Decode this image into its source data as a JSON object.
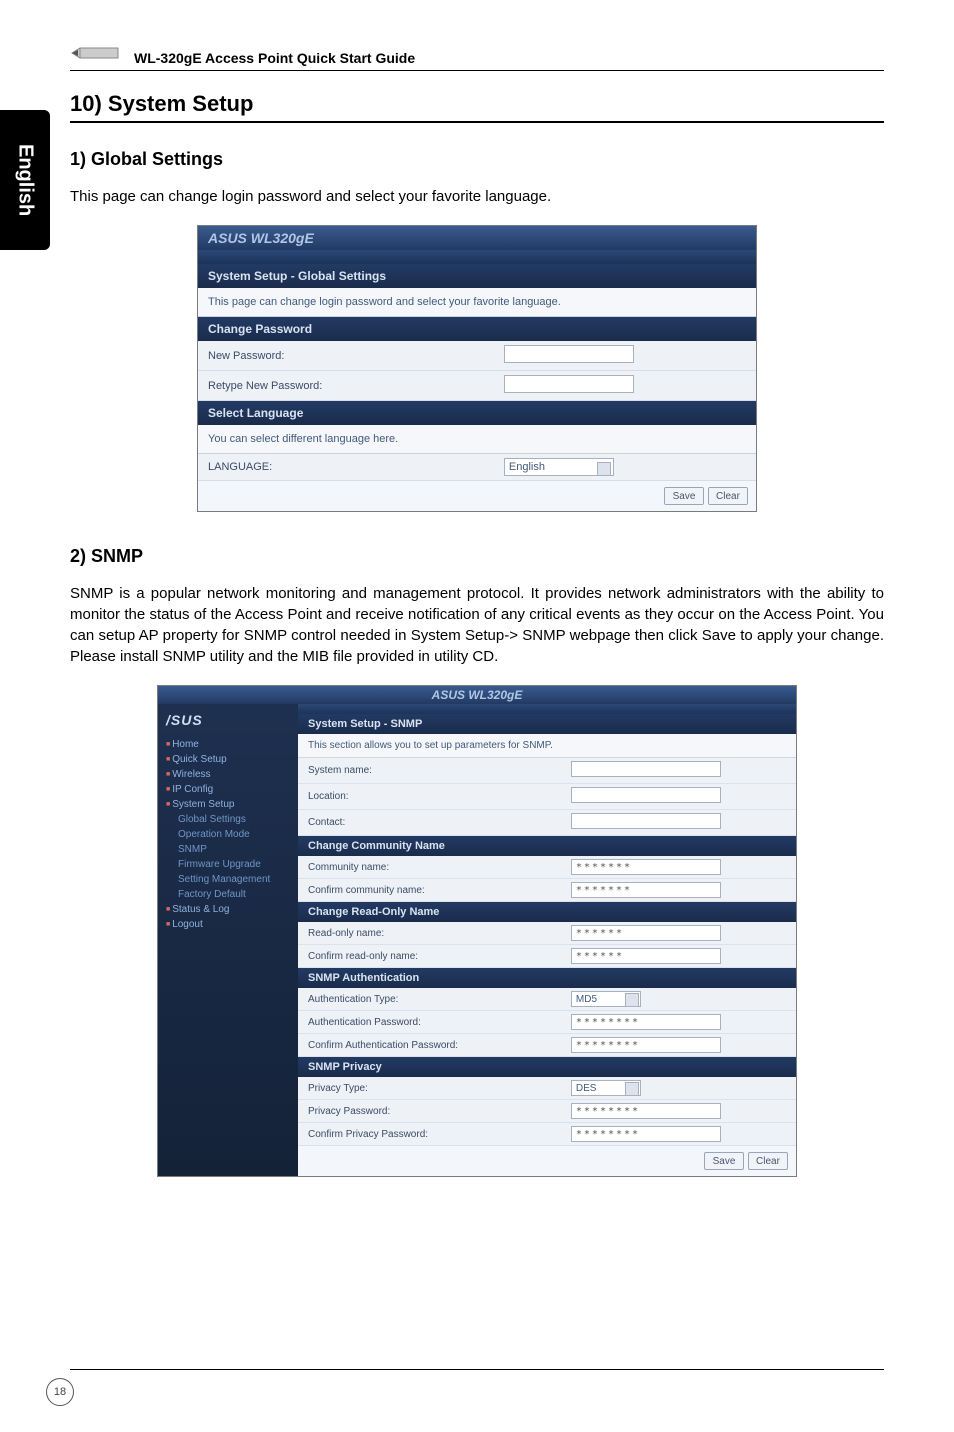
{
  "doc": {
    "language_tab": "English",
    "header_title": "WL-320gE Access Point Quick Start Guide",
    "page_number": "18"
  },
  "section10": {
    "title": "10) System Setup",
    "sub1_title": "1) Global Settings",
    "sub1_text": "This page can change login password and select your favorite language.",
    "sub2_title": "2) SNMP",
    "sub2_text": "SNMP is a popular network monitoring and management protocol. It provides network administrators with the ability to monitor the status of the Access Point and receive notification of any critical events as they occur on the Access Point. You can setup AP property for SNMP control needed in System Setup-> SNMP webpage then click Save to apply your change. Please install SNMP utility and the MIB file provided in utility CD."
  },
  "screenshot1": {
    "product": "ASUS WL320gE",
    "panel_title": "System Setup - Global Settings",
    "panel_desc": "This page can change login password and select your favorite language.",
    "sec_changepw": "Change Password",
    "row_newpw": "New Password:",
    "row_retype": "Retype New Password:",
    "sec_lang": "Select Language",
    "lang_desc": "You can select different language here.",
    "row_lang": "LANGUAGE:",
    "lang_value": "English",
    "btn_save": "Save",
    "btn_clear": "Clear"
  },
  "screenshot2": {
    "product": "ASUS WL320gE",
    "side_logo": "/SUS",
    "nav": [
      {
        "lvl": "l1",
        "t": "Home"
      },
      {
        "lvl": "l1",
        "t": "Quick Setup"
      },
      {
        "lvl": "l1",
        "t": "Wireless"
      },
      {
        "lvl": "l1",
        "t": "IP Config"
      },
      {
        "lvl": "l1",
        "t": "System Setup"
      },
      {
        "lvl": "l2",
        "t": "Global Settings"
      },
      {
        "lvl": "l2",
        "t": "Operation Mode"
      },
      {
        "lvl": "l2",
        "t": "SNMP"
      },
      {
        "lvl": "l2",
        "t": "Firmware Upgrade"
      },
      {
        "lvl": "l2",
        "t": "Setting Management"
      },
      {
        "lvl": "l2",
        "t": "Factory Default"
      },
      {
        "lvl": "l1",
        "t": "Status & Log"
      },
      {
        "lvl": "l1",
        "t": "Logout"
      }
    ],
    "panel_title": "System Setup - SNMP",
    "panel_desc": "This section allows you to set up parameters for SNMP.",
    "row_sysname": "System name:",
    "row_location": "Location:",
    "row_contact": "Contact:",
    "sec_comm": "Change Community Name",
    "row_commname": "Community name:",
    "row_commconf": "Confirm community name:",
    "sec_ro": "Change Read-Only Name",
    "row_roname": "Read-only name:",
    "row_roconf": "Confirm read-only name:",
    "sec_auth": "SNMP Authentication",
    "row_authtype": "Authentication Type:",
    "auth_value": "MD5",
    "row_authpw": "Authentication Password:",
    "row_authpwc": "Confirm Authentication Password:",
    "sec_priv": "SNMP Privacy",
    "row_privtype": "Privacy Type:",
    "priv_value": "DES",
    "row_privpw": "Privacy Password:",
    "row_privpwc": "Confirm Privacy Password:",
    "masked6": "******",
    "masked7": "*******",
    "masked8": "********",
    "btn_save": "Save",
    "btn_clear": "Clear"
  }
}
